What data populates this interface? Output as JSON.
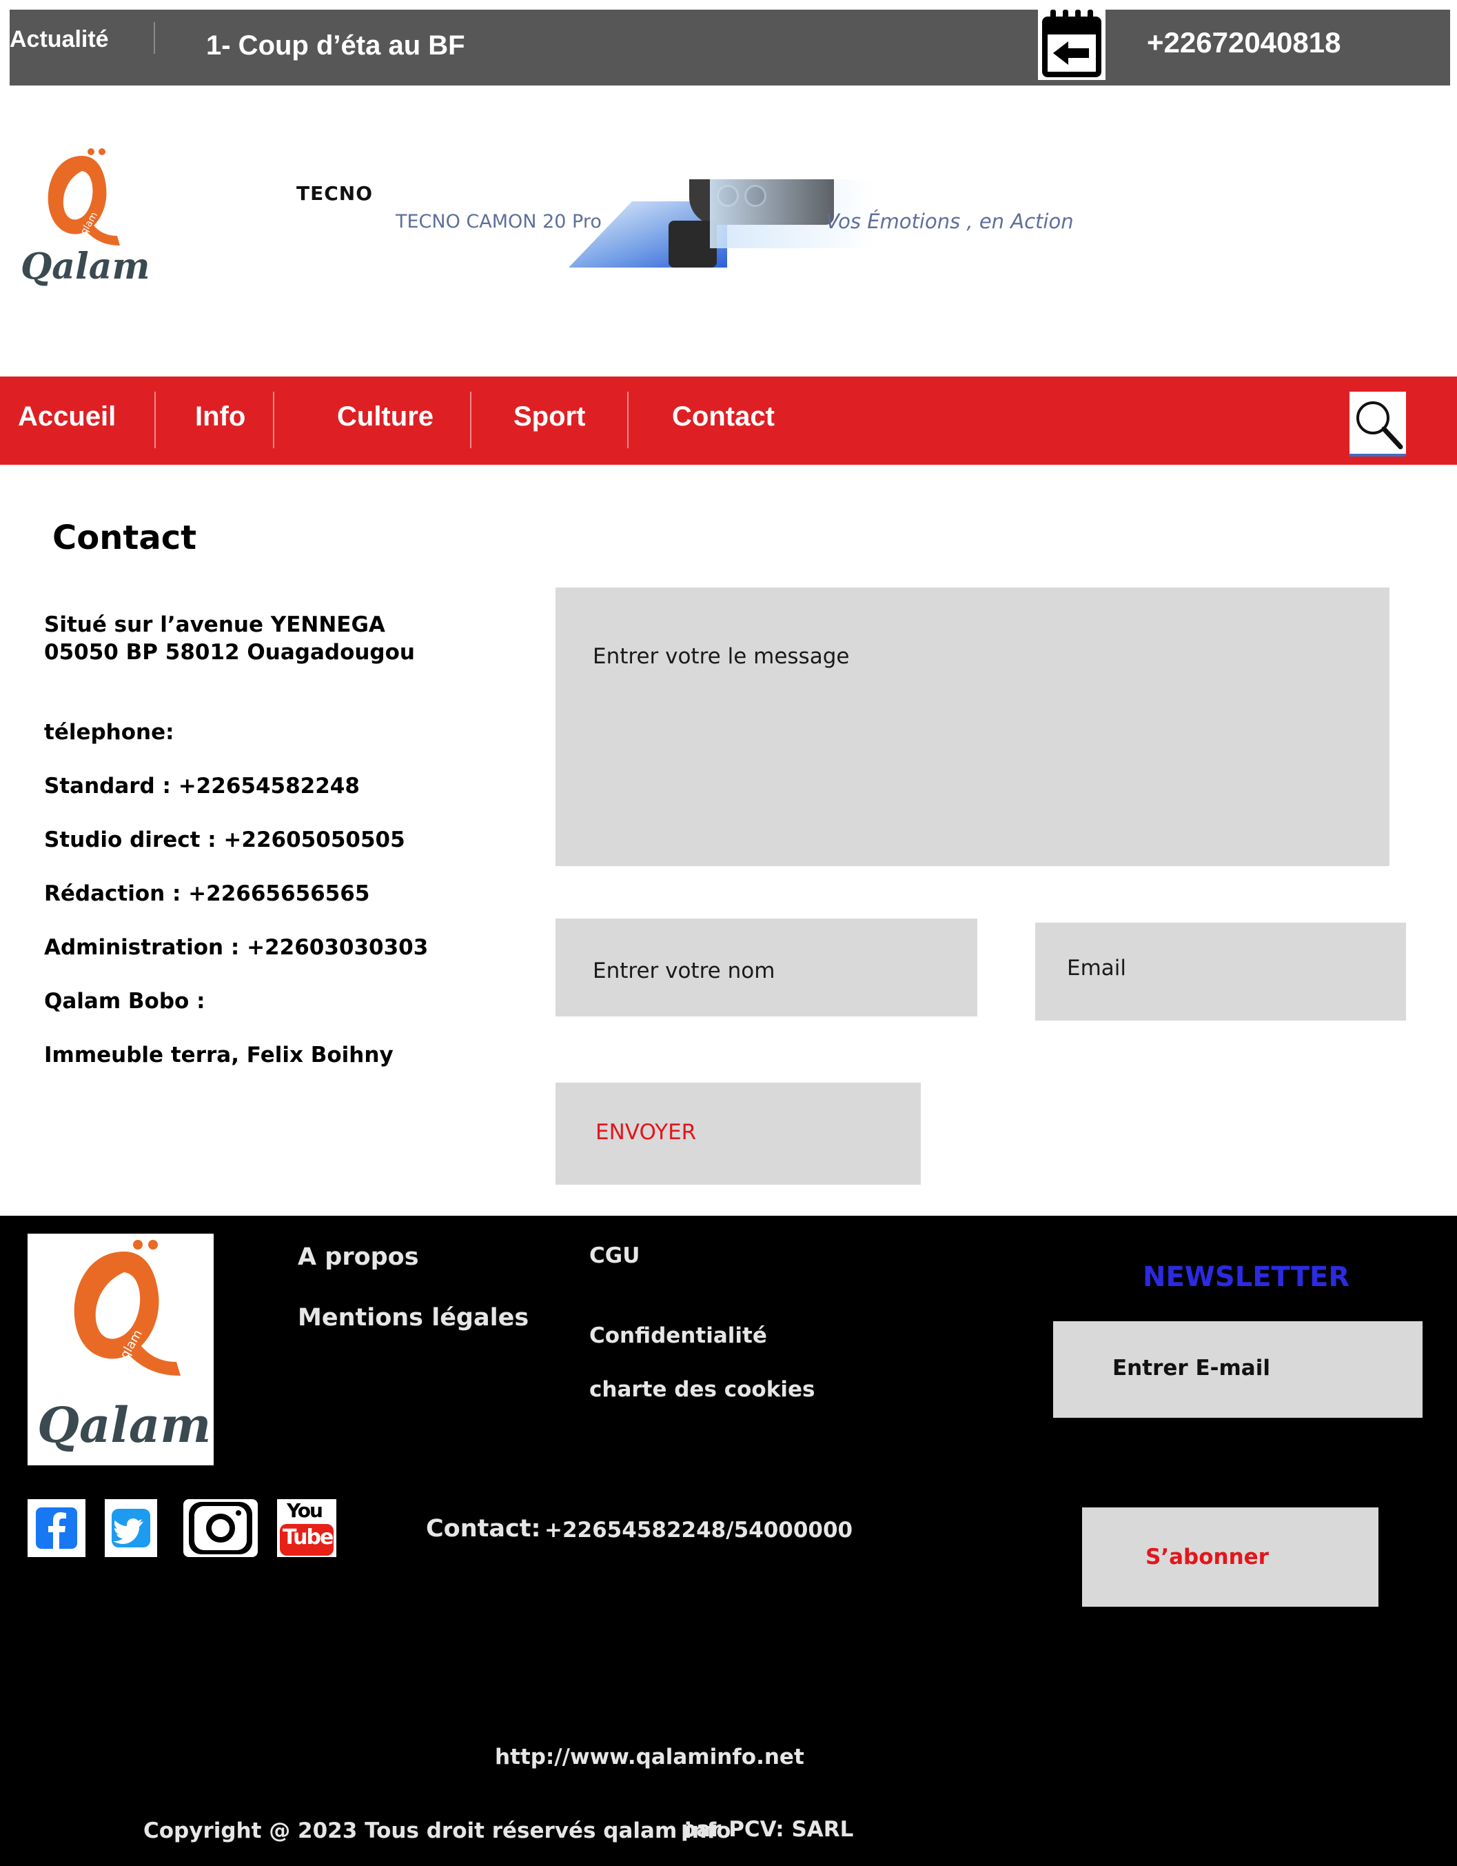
{
  "topbar": {
    "section_label": "Actualité",
    "headline": "1- Coup d’éta  au BF",
    "phone": "+22672040818",
    "calendar_icon": "calendar-back-icon"
  },
  "header": {
    "logo_text": "Qalam",
    "logo_small": "qlam",
    "ad": {
      "brand": "TECNO",
      "product": "TECNO CAMON 20 Pro",
      "tagline": "Vos Émotions , en Action"
    }
  },
  "nav": {
    "items": [
      "Accueil",
      "Info",
      "Culture",
      "Sport",
      "Contact"
    ],
    "search_icon": "search-icon"
  },
  "contact": {
    "title": "Contact",
    "address_line1": "Situé sur l’avenue YENNEGA",
    "address_line2": "05050 BP 58012 Ouagadougou",
    "phone_label": "télephone:",
    "standard": "Standard : +22654582248",
    "studio": "Studio direct : +22605050505",
    "redaction": "Rédaction : +22665656565",
    "administration": "Administration : +22603030303",
    "bobo_label": "Qalam Bobo :",
    "bobo_address": "Immeuble terra, Felix Boihny"
  },
  "form": {
    "message_placeholder": "Entrer votre le message",
    "name_placeholder": "Entrer votre nom",
    "email_placeholder": "Email",
    "submit_label": "ENVOYER"
  },
  "footer": {
    "logo_text": "Qalam",
    "logo_small": "qlam",
    "links_col1": [
      "A propos",
      "Mentions légales"
    ],
    "links_col2": [
      "CGU",
      "Confidentialité",
      "charte des cookies"
    ],
    "newsletter_title": "NEWSLETTER",
    "newsletter_placeholder": "Entrer E-mail",
    "subscribe_label": "S’abonner",
    "contact_label": "Contact:",
    "contact_value": "+22654582248/54000000",
    "social": [
      "facebook-icon",
      "twitter-icon",
      "instagram-icon",
      "youtube-icon"
    ],
    "youtube_you": "You",
    "youtube_tube": "Tube",
    "url": "http://www.qalaminfo.net",
    "copyright": "Copyright @ 2023 Tous droit réservés  qalam info",
    "copyright_by": "par PCV: SARL"
  },
  "colors": {
    "topbar_bg": "#575757",
    "nav_bg": "#de2024",
    "footer_bg": "#000000",
    "field_bg": "#d9d9d9",
    "submit_text": "#e3161b",
    "newsletter_title": "#2b2be0",
    "logo_orange": "#e96a25"
  }
}
